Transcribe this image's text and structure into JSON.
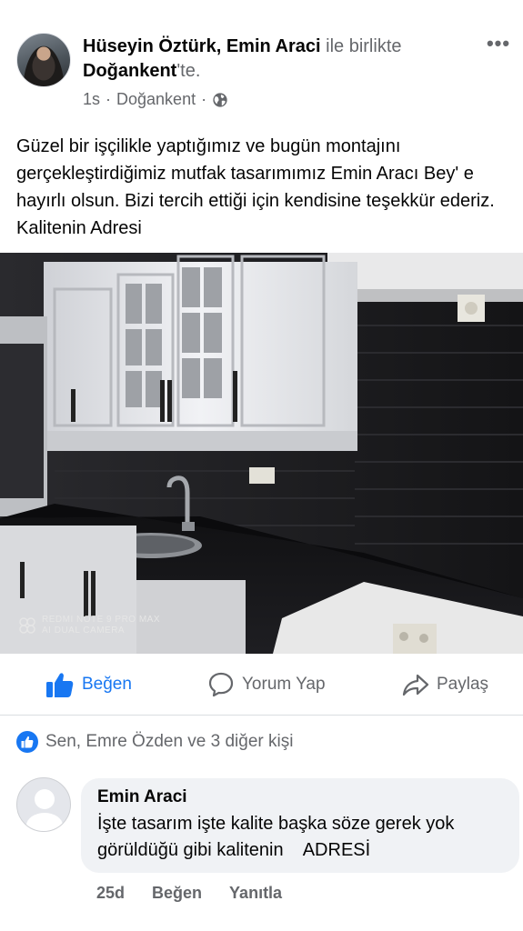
{
  "post": {
    "author": "Hüseyin Öztürk",
    "separator": ", ",
    "tagged": "Emin Araci",
    "with_text": " ile birlikte",
    "location": "Doğankent",
    "location_suffix": "'te.",
    "time": "1s",
    "dot": "·",
    "place": "Doğankent",
    "privacy_icon": "globe-icon",
    "more_icon": "more-options-icon",
    "more_glyph": "•••",
    "text": "Güzel bir işçilikle yaptığımız ve bugün montajını gerçekleştirdiğimiz mutfak tasarımımız Emin Aracı Bey' e hayırlı olsun. Bizi tercih ettiği için kendisine teşekkür ederiz. Kalitenin Adresi"
  },
  "photo": {
    "watermark_line1": "REDMI NOTE 9 PRO MAX",
    "watermark_line2": "AI DUAL CAMERA"
  },
  "actions": {
    "like": "Beğen",
    "comment": "Yorum Yap",
    "share": "Paylaş"
  },
  "reactions": {
    "text": "Sen, Emre Özden ve 3 diğer kişi"
  },
  "comment": {
    "author": "Emin Araci",
    "text": "İşte tasarım işte kalite başka söze gerek yok görüldüğü gibi kalitenin    ADRESİ",
    "time": "25d",
    "like": "Beğen",
    "reply": "Yanıtla"
  },
  "colors": {
    "accent": "#1877f2",
    "muted": "#65676b",
    "bubble": "#f0f2f5"
  }
}
